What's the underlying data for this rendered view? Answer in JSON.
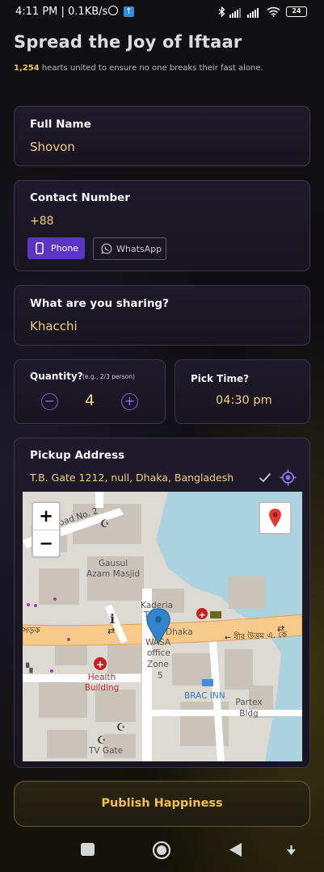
{
  "status_bar": {
    "time": "4:11 PM | 0.1KB/s",
    "battery": "24"
  },
  "header": {
    "title": "Spread the Joy of Iftaar",
    "hearts_count": "1,254",
    "subtitle_text": "hearts united to ensure no one breaks their fast alone."
  },
  "form": {
    "full_name": {
      "label": "Full Name",
      "value": "Shovon"
    },
    "contact": {
      "label": "Contact Number",
      "value": "+88",
      "phone_label": "Phone",
      "whatsapp_label": "WhatsApp",
      "selected": "Phone"
    },
    "sharing": {
      "label": "What are you sharing?",
      "value": "Khacchi"
    },
    "quantity": {
      "label": "Quantity?",
      "hint": "(e.g., 2/3 person)",
      "value": "4"
    },
    "pick_time": {
      "label": "Pick Time?",
      "value": "04:30 pm"
    },
    "pickup_address": {
      "label": "Pickup Address",
      "value": "T.B. Gate 1212, null, Dhaka, Bangladesh"
    }
  },
  "map": {
    "zoom_in": "+",
    "zoom_out": "−",
    "labels": {
      "road2": "oad No. 2",
      "mosque": "Gausul Azam Masjid",
      "kaderia": "Kaderia",
      "tower": "Tower",
      "dhaka": "Dhaka",
      "wasa": "WASA",
      "office": "office",
      "zone": "Zone",
      "zone_no": "5",
      "health": "Health Building",
      "brac": "BRAC INN",
      "partex": "Partex Bldg",
      "tvgate": "TV Gate",
      "road_bn_left": "সড়ক",
      "road_bn_right": "← বীর উত্তম এ. কে"
    }
  },
  "publish_label": "Publish Happiness",
  "colors": {
    "accent_purple": "#5b35c4",
    "gold": "#efc14a",
    "value_text": "#f1cf83"
  },
  "icons": [
    "alarm-icon",
    "upload-icon",
    "bluetooth-icon",
    "signal-icon",
    "wifi-icon",
    "battery-icon",
    "phone-icon",
    "whatsapp-icon",
    "minus-icon",
    "plus-icon",
    "check-icon",
    "locate-icon",
    "map-pin-icon",
    "recent-apps-icon",
    "home-icon",
    "back-icon",
    "menu-down-icon"
  ]
}
